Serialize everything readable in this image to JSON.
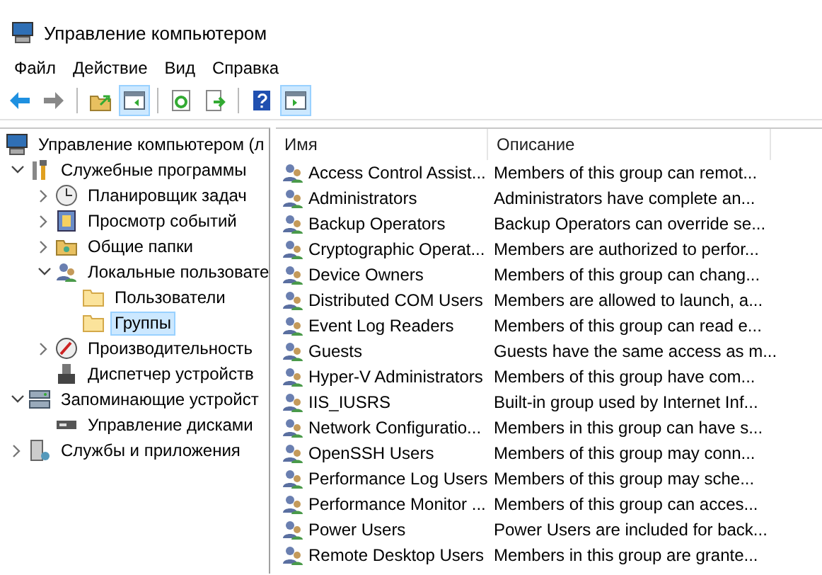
{
  "window": {
    "title": "Управление компьютером"
  },
  "menu": [
    "Файл",
    "Действие",
    "Вид",
    "Справка"
  ],
  "toolbar": {
    "buttons": [
      {
        "kind": "back",
        "pressed": false
      },
      {
        "kind": "forward",
        "pressed": false
      },
      {
        "kind": "up",
        "pressed": false
      },
      {
        "kind": "tree",
        "pressed": true
      },
      {
        "kind": "refresh",
        "pressed": false
      },
      {
        "kind": "export",
        "pressed": false
      },
      {
        "kind": "help",
        "pressed": false
      },
      {
        "kind": "pane",
        "pressed": true
      }
    ]
  },
  "tree": [
    {
      "label": "Управление компьютером (л",
      "kind": "computer",
      "selected": false,
      "children": [
        {
          "label": "Служебные программы",
          "kind": "tools",
          "selected": false,
          "expanded": true,
          "children": [
            {
              "label": "Планировщик задач",
              "kind": "clock",
              "selected": false,
              "expanded": false
            },
            {
              "label": "Просмотр событий",
              "kind": "log",
              "selected": false,
              "expanded": false
            },
            {
              "label": "Общие папки",
              "kind": "share",
              "selected": false,
              "expanded": false
            },
            {
              "label": "Локальные пользовате",
              "kind": "users",
              "selected": false,
              "expanded": true,
              "children": [
                {
                  "label": "Пользователи",
                  "kind": "folder",
                  "selected": false
                },
                {
                  "label": "Группы",
                  "kind": "folder",
                  "selected": true
                }
              ]
            },
            {
              "label": "Производительность",
              "kind": "gauge",
              "selected": false,
              "expanded": false
            },
            {
              "label": "Диспетчер устройств",
              "kind": "device",
              "selected": false
            }
          ]
        },
        {
          "label": "Запоминающие устройст",
          "kind": "storage",
          "selected": false,
          "expanded": true,
          "children": [
            {
              "label": "Управление дисками",
              "kind": "disk",
              "selected": false
            }
          ]
        },
        {
          "label": "Службы и приложения",
          "kind": "server",
          "selected": false,
          "expanded": false
        }
      ]
    }
  ],
  "table": {
    "columns": [
      "Имя",
      "Описание"
    ],
    "rows": [
      [
        "Access Control Assist...",
        "Members of this group can remot..."
      ],
      [
        "Administrators",
        "Administrators have complete an..."
      ],
      [
        "Backup Operators",
        "Backup Operators can override se..."
      ],
      [
        "Cryptographic Operat...",
        "Members are authorized to perfor..."
      ],
      [
        "Device Owners",
        "Members of this group can chang..."
      ],
      [
        "Distributed COM Users",
        "Members are allowed to launch, a..."
      ],
      [
        "Event Log Readers",
        "Members of this group can read e..."
      ],
      [
        "Guests",
        "Guests have the same access as m..."
      ],
      [
        "Hyper-V Administrators",
        "Members of this group have com..."
      ],
      [
        "IIS_IUSRS",
        "Built-in group used by Internet Inf..."
      ],
      [
        "Network Configuratio...",
        "Members in this group can have s..."
      ],
      [
        "OpenSSH Users",
        "Members of this group may conn..."
      ],
      [
        "Performance Log Users",
        "Members of this group may sche..."
      ],
      [
        "Performance Monitor ...",
        "Members of this group can acces..."
      ],
      [
        "Power Users",
        "Power Users are included for back..."
      ],
      [
        "Remote Desktop Users",
        "Members in this group are grante..."
      ]
    ]
  }
}
